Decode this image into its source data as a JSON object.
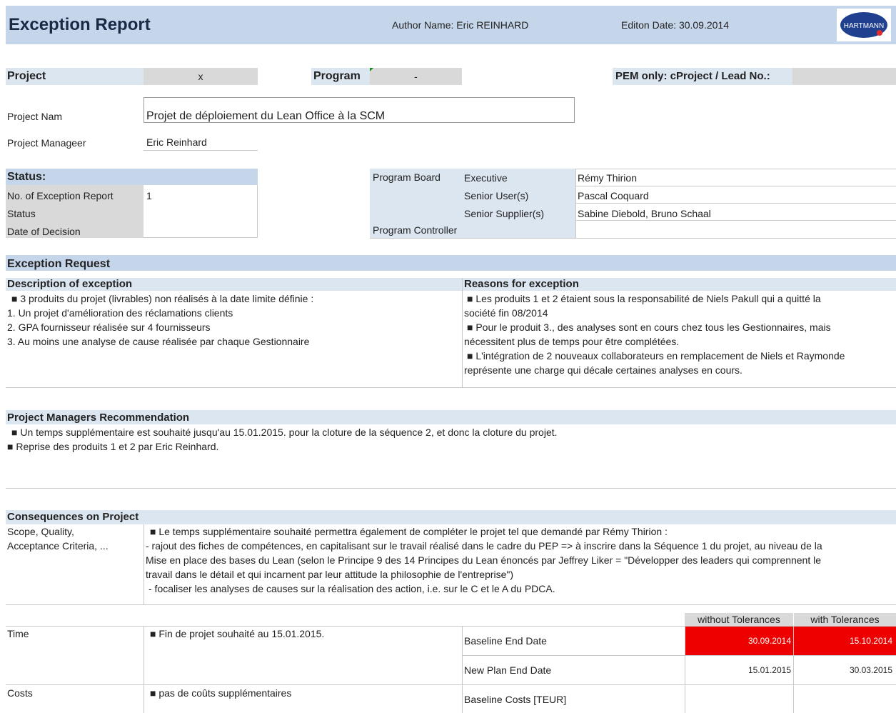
{
  "header": {
    "title": "Exception Report",
    "author": "Author Name: Eric REINHARD",
    "edition": "Editon Date: 30.09.2014",
    "logo_text": "HARTMANN"
  },
  "project_row": {
    "project_label": "Project",
    "project_value": "x",
    "program_label": "Program",
    "program_value": "-",
    "pem_label": "PEM only: cProject / Lead No.:",
    "pem_value": ""
  },
  "project_info": {
    "name_label": "Project Nam",
    "name_value": "Projet de déploiement du Lean Office à la SCM",
    "manager_label": "Project Manageer",
    "manager_value": "Eric Reinhard"
  },
  "status": {
    "title": "Status:",
    "rows": [
      {
        "label": "No. of Exception Report",
        "value": "1"
      },
      {
        "label": "Status",
        "value": ""
      },
      {
        "label": "Date of Decision",
        "value": ""
      }
    ]
  },
  "program_board": {
    "label": "Program Board",
    "rows": [
      {
        "role": "Executive",
        "name": "Rémy Thirion"
      },
      {
        "role": "Senior User(s)",
        "name": "Pascal Coquard"
      },
      {
        "role": "Senior Supplier(s)",
        "name": "Sabine Diebold, Bruno Schaal"
      }
    ],
    "controller_label": "Program Controller",
    "controller_value": ""
  },
  "exception_request": {
    "title": "Exception Request",
    "description_title": "Description of exception",
    "description_lines": [
      "■ 3 produits du projet (livrables) non réalisés à la date limite définie :",
      "1. Un projet d'amélioration des réclamations clients",
      "2. GPA fournisseur réalisée sur 4 fournisseurs",
      "3. Au moins une analyse de cause réalisée par chaque Gestionnaire"
    ],
    "reasons_title": "Reasons for exception",
    "reasons_lines": [
      "■ Les produits 1 et 2 étaient sous la responsabilité de Niels Pakull qui a quitté la",
      "société fin 08/2014",
      "■ Pour le produit 3., des analyses sont en cours chez tous les Gestionnaires, mais",
      "nécessitent plus de temps pour être complétées.",
      "■ L'intégration de 2 nouveaux collaborateurs en remplacement de Niels et Raymonde",
      "représente une charge qui décale certaines analyses en cours."
    ]
  },
  "recommendation": {
    "title": "Project Managers Recommendation",
    "lines": [
      "■ Un temps supplémentaire est souhaité jusqu'au 15.01.2015. pour la cloture de la séquence 2, et donc la cloture du projet.",
      "■ Reprise des produits 1 et 2 par Eric Reinhard."
    ]
  },
  "consequences": {
    "title": "Consequences on Project",
    "scope_label_1": "Scope, Quality,",
    "scope_label_2": "Acceptance Criteria, ...",
    "scope_lines": [
      "■ Le temps supplémentaire souhaité permettra également de compléter le projet tel que demandé par Rémy Thirion :",
      "- rajout des fiches de compétences, en capitalisant sur le travail réalisé dans le cadre du PEP => à inscrire dans la Séquence 1 du projet, au niveau de la",
      "Mise en place des bases du Lean (selon le Principe 9 des 14 Principes du Lean énoncés par Jeffrey Liker = \"Développer des leaders qui comprennent le",
      "travail dans le détail et qui incarnent par leur attitude la philosophie de l'entreprise\")",
      " - focaliser les analyses de causes sur la réalisation des action, i.e. sur le C et le A du PDCA."
    ]
  },
  "tolerance_table": {
    "col_without": "without Tolerances",
    "col_with": "with Tolerances",
    "time_label": "Time",
    "time_text": "■ Fin de projet souhaité au 15.01.2015.",
    "costs_label": "Costs",
    "costs_text": "■ pas de coûts supplémentaires",
    "rows": [
      {
        "label": "Baseline End Date",
        "without": "30.09.2014",
        "with": "15.10.2014"
      },
      {
        "label": "New Plan End Date",
        "without": "15.01.2015",
        "with": "30.03.2015"
      },
      {
        "label": "Baseline Costs [TEUR]",
        "without": "",
        "with": ""
      }
    ],
    "highlight_color": "#ee0000"
  }
}
